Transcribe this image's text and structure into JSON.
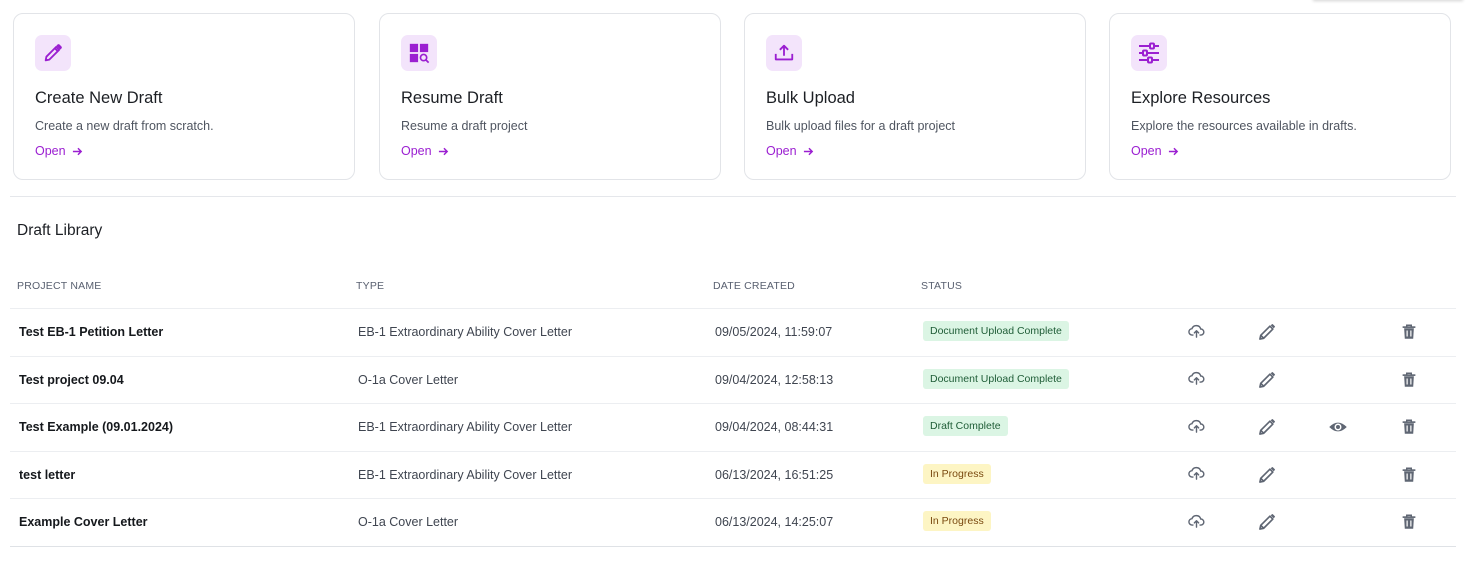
{
  "cards": [
    {
      "title": "Create New Draft",
      "description": "Create a new draft from scratch.",
      "link_label": "Open",
      "icon": "pencil-icon"
    },
    {
      "title": "Resume Draft",
      "description": "Resume a draft project",
      "link_label": "Open",
      "icon": "grid-search-icon"
    },
    {
      "title": "Bulk Upload",
      "description": "Bulk upload files for a draft project",
      "link_label": "Open",
      "icon": "upload-tray-icon"
    },
    {
      "title": "Explore Resources",
      "description": "Explore the resources available in drafts.",
      "link_label": "Open",
      "icon": "sliders-icon"
    }
  ],
  "library": {
    "title": "Draft Library",
    "columns": {
      "name": "PROJECT NAME",
      "type": "TYPE",
      "date": "DATE CREATED",
      "status": "STATUS"
    },
    "rows": [
      {
        "name": "Test EB-1 Petition Letter",
        "type": "EB-1 Extraordinary Ability Cover Letter",
        "date": "09/05/2024, 11:59:07",
        "status": "Document Upload Complete",
        "status_color": "green",
        "has_view": false
      },
      {
        "name": "Test project 09.04",
        "type": "O-1a Cover Letter",
        "date": "09/04/2024, 12:58:13",
        "status": "Document Upload Complete",
        "status_color": "green",
        "has_view": false
      },
      {
        "name": "Test Example (09.01.2024)",
        "type": "EB-1 Extraordinary Ability Cover Letter",
        "date": "09/04/2024, 08:44:31",
        "status": "Draft Complete",
        "status_color": "green",
        "has_view": true
      },
      {
        "name": "test letter",
        "type": "EB-1 Extraordinary Ability Cover Letter",
        "date": "06/13/2024, 16:51:25",
        "status": "In Progress",
        "status_color": "yellow",
        "has_view": false
      },
      {
        "name": "Example Cover Letter",
        "type": "O-1a Cover Letter",
        "date": "06/13/2024, 14:25:07",
        "status": "In Progress",
        "status_color": "yellow",
        "has_view": false
      }
    ]
  },
  "colors": {
    "accent": "#9b1fd1",
    "icon_tile": "#f3e4fb",
    "action_icon": "#6b7280"
  }
}
